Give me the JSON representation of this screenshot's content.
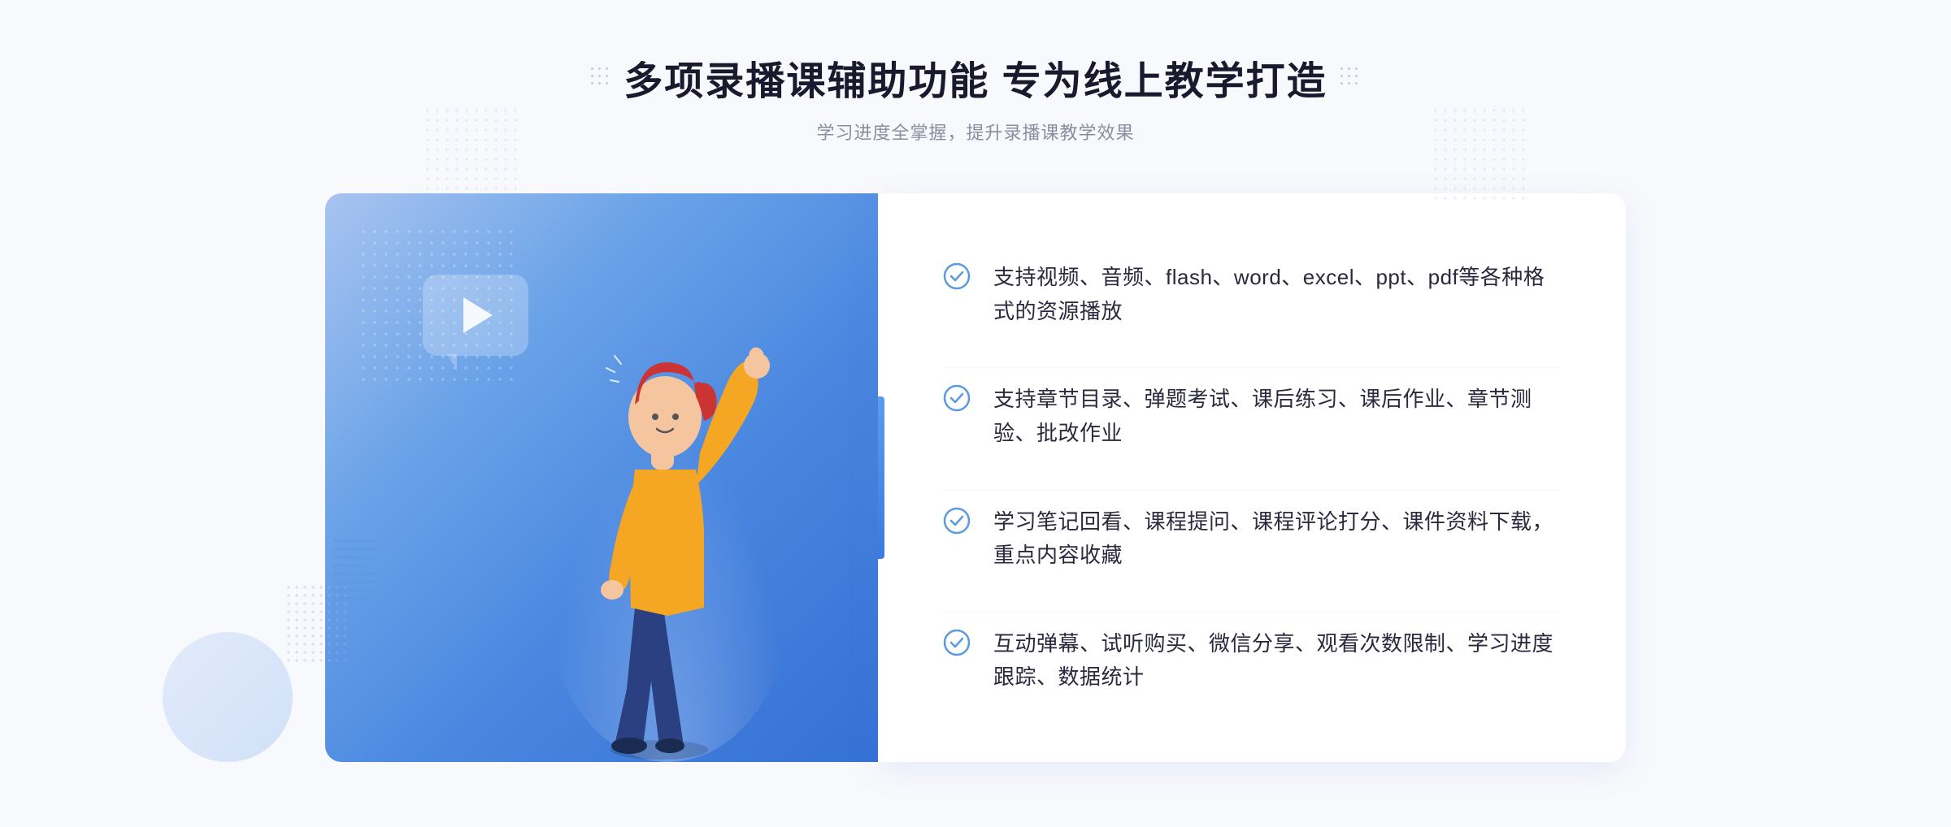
{
  "page": {
    "background_color": "#f8f9fc"
  },
  "header": {
    "main_title": "多项录播课辅助功能 专为线上教学打造",
    "sub_title": "学习进度全掌握，提升录播课教学效果"
  },
  "features": [
    {
      "id": "feature-1",
      "text": "支持视频、音频、flash、word、excel、ppt、pdf等各种格式的资源播放"
    },
    {
      "id": "feature-2",
      "text": "支持章节目录、弹题考试、课后练习、课后作业、章节测验、批改作业"
    },
    {
      "id": "feature-3",
      "text": "学习笔记回看、课程提问、课程评论打分、课件资料下载，重点内容收藏"
    },
    {
      "id": "feature-4",
      "text": "互动弹幕、试听购买、微信分享、观看次数限制、学习进度跟踪、数据统计"
    }
  ],
  "icons": {
    "check": "check-circle-icon",
    "play": "play-icon",
    "left_arrow": "left-arrow-icon"
  },
  "colors": {
    "accent_blue": "#3a7be0",
    "light_blue": "#6ba3e8",
    "title_color": "#1a1a2e",
    "text_color": "#2a2a3e",
    "subtitle_color": "#888ea0",
    "check_color": "#5a9ae0"
  }
}
